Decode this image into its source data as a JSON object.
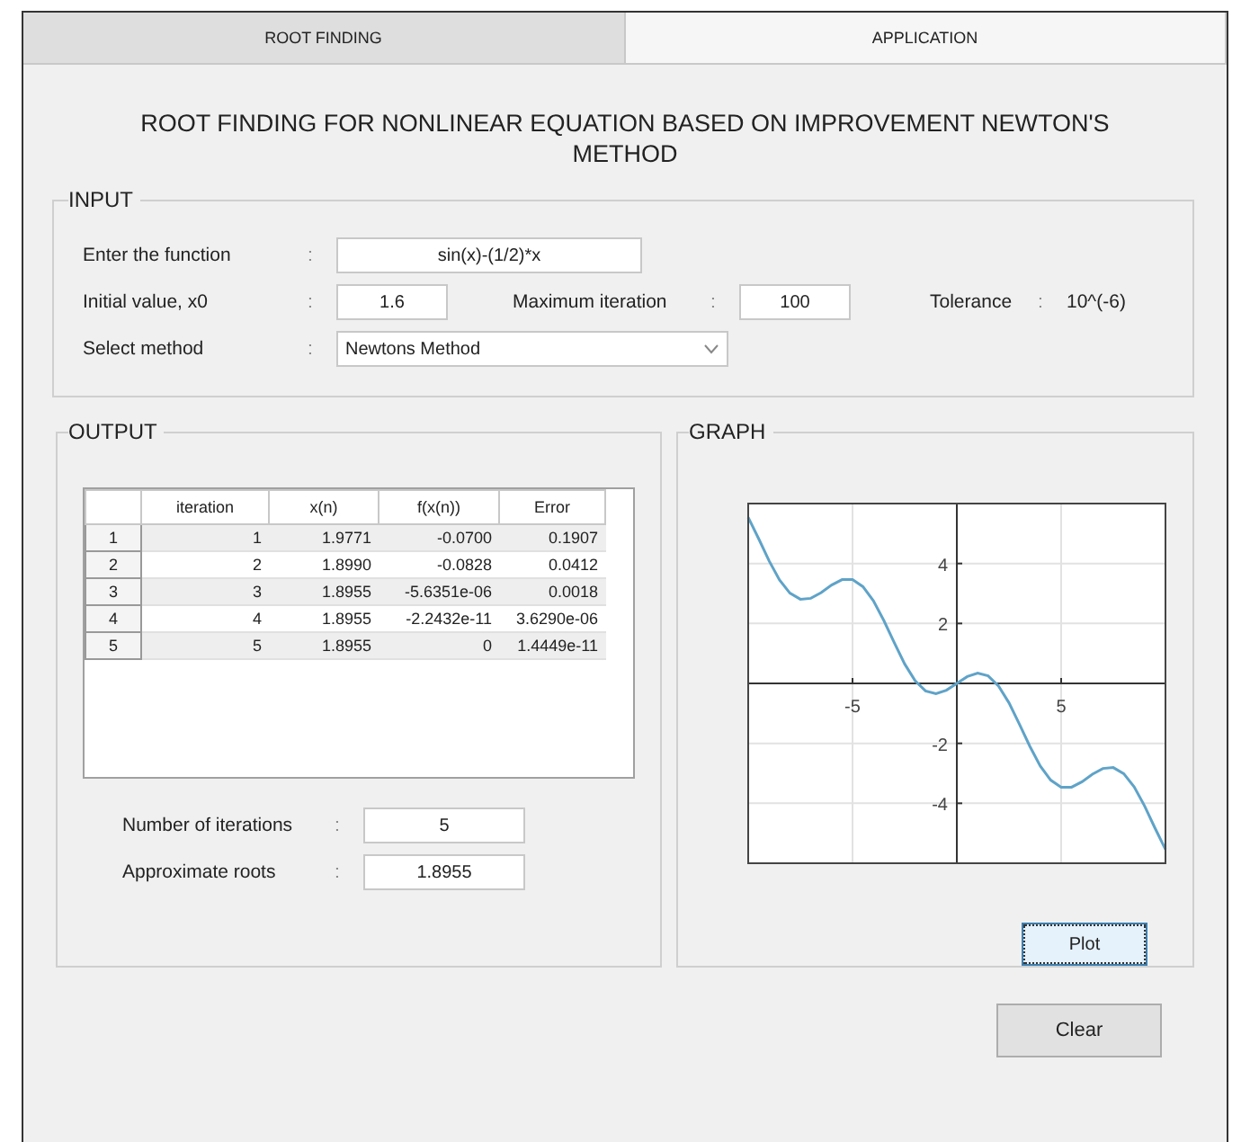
{
  "tabs": [
    {
      "label": "ROOT FINDING",
      "selected": true
    },
    {
      "label": "APPLICATION",
      "selected": false
    }
  ],
  "title": "ROOT FINDING FOR NONLINEAR EQUATION BASED ON IMPROVEMENT NEWTON'S METHOD",
  "input": {
    "legend": "INPUT",
    "function": {
      "label": "Enter the function",
      "colon": ":",
      "value": "sin(x)-(1/2)*x"
    },
    "initial": {
      "label": "Initial value, x0",
      "colon": ":",
      "value": "1.6"
    },
    "max_iter": {
      "label": "Maximum iteration",
      "colon": ":",
      "value": "100"
    },
    "tolerance": {
      "label": "Tolerance",
      "colon": ":",
      "value": "10^(-6)"
    },
    "method": {
      "label": "Select method",
      "colon": ":",
      "value": "Newtons Method"
    }
  },
  "output": {
    "legend": "OUTPUT",
    "table": {
      "columns": [
        "",
        "iteration",
        "x(n)",
        "f(x(n))",
        "Error"
      ],
      "rows": [
        [
          "1",
          "1",
          "1.9771",
          "-0.0700",
          "0.1907"
        ],
        [
          "2",
          "2",
          "1.8990",
          "-0.0828",
          "0.0412"
        ],
        [
          "3",
          "3",
          "1.8955",
          "-5.6351e-06",
          "0.0018"
        ],
        [
          "4",
          "4",
          "1.8955",
          "-2.2432e-11",
          "3.6290e-06"
        ],
        [
          "5",
          "5",
          "1.8955",
          "0",
          "1.4449e-11"
        ]
      ]
    },
    "iterations": {
      "label": "Number of iterations",
      "colon": ":",
      "value": "5"
    },
    "roots": {
      "label": "Approximate roots",
      "colon": ":",
      "value": "1.8955"
    }
  },
  "graph": {
    "legend": "GRAPH",
    "button": "Plot",
    "chart_data": {
      "type": "line",
      "xlim": [
        -10,
        10
      ],
      "ylim": [
        -6,
        6
      ],
      "xticks": [
        {
          "value": -5,
          "label": "-5"
        },
        {
          "value": 5,
          "label": "5"
        }
      ],
      "yticks": [
        {
          "value": -4,
          "label": "-4"
        },
        {
          "value": -2,
          "label": "-2"
        },
        {
          "value": 2,
          "label": "2"
        },
        {
          "value": 4,
          "label": "4"
        }
      ],
      "x": [
        -10,
        -9.5,
        -9,
        -8.5,
        -8,
        -7.5,
        -7,
        -6.5,
        -6,
        -5.5,
        -5,
        -4.5,
        -4,
        -3.5,
        -3,
        -2.5,
        -2,
        -1.5,
        -1,
        -0.5,
        0,
        0.5,
        1,
        1.5,
        2,
        2.5,
        3,
        3.5,
        4,
        4.5,
        5,
        5.5,
        6,
        6.5,
        7,
        7.5,
        8,
        8.5,
        9,
        9.5,
        10
      ],
      "grid": true,
      "series": [
        {
          "color": "#5fa3c8",
          "values": [
            5.54,
            4.83,
            4.09,
            3.45,
            3.01,
            2.81,
            2.84,
            3.03,
            3.28,
            3.46,
            3.46,
            3.23,
            2.76,
            2.1,
            1.36,
            0.65,
            0.09,
            -0.25,
            -0.34,
            -0.23,
            0,
            0.23,
            0.34,
            0.25,
            -0.09,
            -0.65,
            -1.36,
            -2.1,
            -2.76,
            -3.23,
            -3.46,
            -3.46,
            -3.28,
            -3.03,
            -2.84,
            -2.81,
            -3.01,
            -3.45,
            -4.09,
            -4.83,
            -5.54
          ]
        }
      ]
    }
  },
  "clear_button": "Clear"
}
